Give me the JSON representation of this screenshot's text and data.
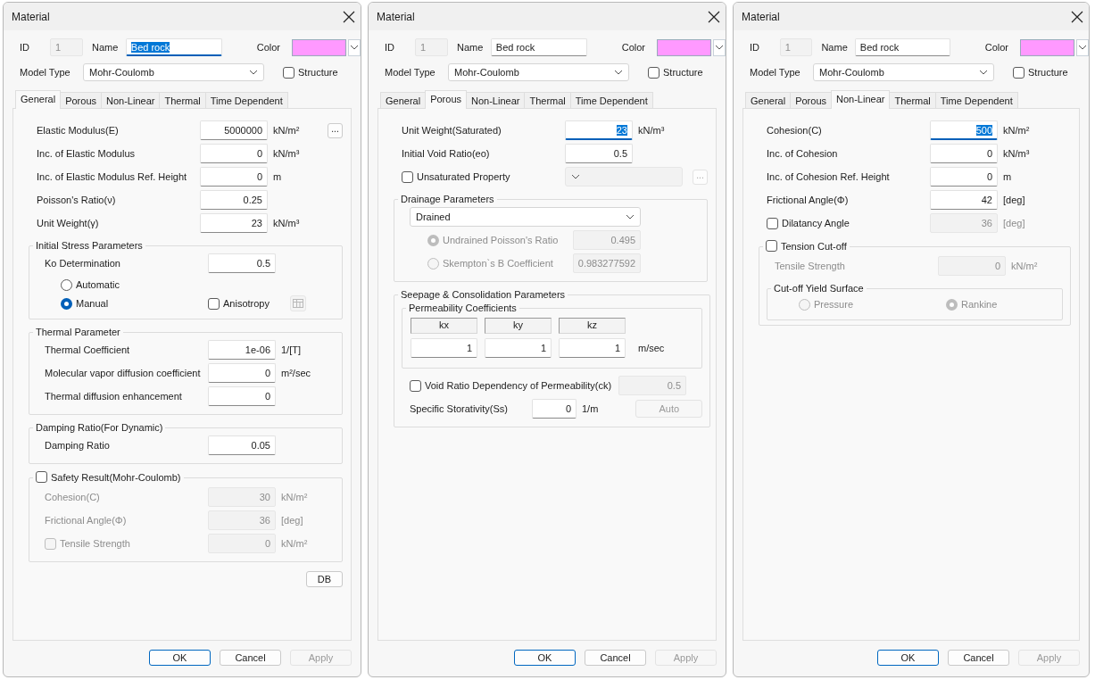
{
  "dialogs": [
    {
      "title": "Material",
      "id_label": "ID",
      "id": {
        "value": "1",
        "disabled": true
      },
      "name_label": "Name",
      "name": {
        "value": "Bed rock",
        "focused": true
      },
      "color_label": "Color",
      "color": "#ff99ff",
      "model_type_label": "Model Type",
      "model_type": "Mohr-Coulomb",
      "structure": {
        "label": "Structure",
        "checked": false
      },
      "tabs": [
        {
          "label": "General",
          "selected": true
        },
        {
          "label": "Porous",
          "selected": false
        },
        {
          "label": "Non-Linear",
          "selected": false
        },
        {
          "label": "Thermal",
          "selected": false
        },
        {
          "label": "Time Dependent",
          "selected": false
        }
      ],
      "content": [
        {
          "kind": "field",
          "label": "Elastic Modulus(E)",
          "value": "5000000",
          "unit": "kN/m²",
          "disabled": false,
          "input_disabled": false,
          "focused": false,
          "more_button": "..."
        },
        {
          "kind": "field",
          "label": "Inc. of Elastic Modulus",
          "value": "0",
          "unit": "kN/m³",
          "disabled": false,
          "input_disabled": false,
          "focused": false
        },
        {
          "kind": "field",
          "label": "Inc. of Elastic Modulus Ref. Height",
          "value": "0",
          "unit": "m",
          "disabled": false,
          "input_disabled": false,
          "focused": false
        },
        {
          "kind": "field",
          "label": "Poisson's Ratio(ν)",
          "value": "0.25",
          "disabled": false,
          "input_disabled": false,
          "focused": false
        },
        {
          "kind": "field",
          "label": "Unit Weight(γ)",
          "value": "23",
          "unit": "kN/m³",
          "disabled": false,
          "input_disabled": false,
          "focused": false
        },
        {
          "kind": "group",
          "title": "Initial Stress Parameters",
          "rows": [
            {
              "kind": "field",
              "label": "Ko Determination",
              "value": "0.5",
              "disabled": false,
              "input_disabled": false,
              "focused": false
            },
            {
              "kind": "options",
              "items": [
                {
                  "kind": "radio",
                  "label": "Automatic",
                  "selected": false,
                  "disabled": false
                }
              ]
            },
            {
              "kind": "options",
              "items": [
                {
                  "kind": "radio",
                  "label": "Manual",
                  "selected": true,
                  "disabled": false
                },
                {
                  "kind": "checkbox",
                  "label": "Anisotropy",
                  "checked": false,
                  "disabled": false
                },
                {
                  "kind": "icon_button",
                  "disabled": true
                }
              ]
            }
          ]
        },
        {
          "kind": "group",
          "title": "Thermal Parameter",
          "rows": [
            {
              "kind": "field",
              "label": "Thermal Coefficient",
              "value": "1e-06",
              "unit": "1/[T]",
              "disabled": false,
              "input_disabled": false,
              "focused": false
            },
            {
              "kind": "field",
              "label": "Molecular vapor diffusion coefficient",
              "value": "0",
              "unit": "m²/sec",
              "disabled": false,
              "input_disabled": false,
              "focused": false
            },
            {
              "kind": "field",
              "label": "Thermal diffusion enhancement",
              "value": "0",
              "disabled": false,
              "input_disabled": false,
              "focused": false
            }
          ]
        },
        {
          "kind": "group",
          "title": "Damping Ratio(For Dynamic)",
          "rows": [
            {
              "kind": "field",
              "label": "Damping Ratio",
              "value": "0.05",
              "disabled": false,
              "input_disabled": false,
              "focused": false
            }
          ]
        },
        {
          "kind": "group",
          "title": "Safety Result(Mohr-Coulomb)",
          "checkbox": {
            "checked": false
          },
          "rows": [
            {
              "kind": "field",
              "label": "Cohesion(C)",
              "value": "30",
              "unit": "kN/m²",
              "disabled": true,
              "input_disabled": true,
              "focused": false
            },
            {
              "kind": "field",
              "label": "Frictional Angle(Φ)",
              "value": "36",
              "unit": "[deg]",
              "disabled": true,
              "input_disabled": true,
              "focused": false
            },
            {
              "kind": "field",
              "label": "Tensile Strength",
              "toggle": {
                "kind": "checkbox",
                "checked": false
              },
              "value": "0",
              "unit": "kN/m²",
              "disabled": true,
              "input_disabled": true,
              "focused": false
            }
          ]
        },
        {
          "kind": "button_row",
          "label": "DB"
        }
      ],
      "buttons": [
        {
          "label": "OK",
          "default": true,
          "disabled": false
        },
        {
          "label": "Cancel",
          "default": false,
          "disabled": false
        },
        {
          "label": "Apply",
          "default": false,
          "disabled": true
        }
      ]
    },
    {
      "title": "Material",
      "id_label": "ID",
      "id": {
        "value": "1",
        "disabled": true
      },
      "name_label": "Name",
      "name": {
        "value": "Bed rock",
        "focused": false
      },
      "color_label": "Color",
      "color": "#ff99ff",
      "model_type_label": "Model Type",
      "model_type": "Mohr-Coulomb",
      "structure": {
        "label": "Structure",
        "checked": false
      },
      "tabs": [
        {
          "label": "General",
          "selected": false
        },
        {
          "label": "Porous",
          "selected": true
        },
        {
          "label": "Non-Linear",
          "selected": false
        },
        {
          "label": "Thermal",
          "selected": false
        },
        {
          "label": "Time Dependent",
          "selected": false
        }
      ],
      "content": [
        {
          "kind": "field",
          "label": "Unit Weight(Saturated)",
          "value": "23",
          "unit": "kN/m³",
          "disabled": false,
          "input_disabled": false,
          "focused": true
        },
        {
          "kind": "field",
          "label": "Initial Void Ratio(eo)",
          "value": "0.5",
          "disabled": false,
          "input_disabled": false,
          "focused": false
        },
        {
          "kind": "field_select",
          "label": "Unsaturated Property",
          "toggle": {
            "kind": "checkbox",
            "checked": false
          },
          "disabled": false,
          "input_disabled": true,
          "more_button": "..."
        },
        {
          "kind": "group",
          "title": "Drainage Parameters",
          "rows": [
            {
              "kind": "select",
              "value": "Drained"
            },
            {
              "kind": "field",
              "label": "Undrained Poisson's Ratio",
              "toggle": {
                "kind": "radio",
                "selected": true
              },
              "value": "0.495",
              "disabled": true,
              "input_disabled": true,
              "focused": false
            },
            {
              "kind": "field",
              "label": "Skempton`s B Coefficient",
              "toggle": {
                "kind": "radio",
                "selected": false
              },
              "value": "0.983277592",
              "disabled": true,
              "input_disabled": true,
              "focused": false
            }
          ]
        },
        {
          "kind": "group",
          "title": "Seepage & Consolidation Parameters",
          "rows": [
            {
              "kind": "matrix",
              "title": "Permeability Coefficients",
              "columns": [
                "kx",
                "ky",
                "kz"
              ],
              "values": [
                "1",
                "1",
                "1"
              ],
              "unit": "m/sec"
            },
            {
              "kind": "field_wide",
              "label": "Void Ratio Dependency of Permeability(ck)",
              "toggle": {
                "kind": "checkbox",
                "checked": false
              },
              "value": "0.5",
              "disabled": false,
              "input_disabled": true,
              "focused": false
            },
            {
              "kind": "field_short",
              "label": "Specific Storativity(Ss)",
              "value": "0",
              "unit": "1/m",
              "disabled": false,
              "input_disabled": false,
              "focused": false,
              "button": {
                "label": "Auto",
                "disabled": true
              }
            }
          ]
        }
      ],
      "buttons": [
        {
          "label": "OK",
          "default": true,
          "disabled": false
        },
        {
          "label": "Cancel",
          "default": false,
          "disabled": false
        },
        {
          "label": "Apply",
          "default": false,
          "disabled": true
        }
      ]
    },
    {
      "title": "Material",
      "id_label": "ID",
      "id": {
        "value": "1",
        "disabled": true
      },
      "name_label": "Name",
      "name": {
        "value": "Bed rock",
        "focused": false
      },
      "color_label": "Color",
      "color": "#ff99ff",
      "model_type_label": "Model Type",
      "model_type": "Mohr-Coulomb",
      "structure": {
        "label": "Structure",
        "checked": false
      },
      "tabs": [
        {
          "label": "General",
          "selected": false
        },
        {
          "label": "Porous",
          "selected": false
        },
        {
          "label": "Non-Linear",
          "selected": true
        },
        {
          "label": "Thermal",
          "selected": false
        },
        {
          "label": "Time Dependent",
          "selected": false
        }
      ],
      "content": [
        {
          "kind": "field",
          "label": "Cohesion(C)",
          "value": "500",
          "unit": "kN/m²",
          "disabled": false,
          "input_disabled": false,
          "focused": true
        },
        {
          "kind": "field",
          "label": "Inc. of Cohesion",
          "value": "0",
          "unit": "kN/m³",
          "disabled": false,
          "input_disabled": false,
          "focused": false
        },
        {
          "kind": "field",
          "label": "Inc. of Cohesion Ref. Height",
          "value": "0",
          "unit": "m",
          "disabled": false,
          "input_disabled": false,
          "focused": false
        },
        {
          "kind": "field",
          "label": "Frictional Angle(Φ)",
          "value": "42",
          "unit": "[deg]",
          "disabled": false,
          "input_disabled": false,
          "focused": false
        },
        {
          "kind": "field",
          "label": "Dilatancy Angle",
          "toggle": {
            "kind": "checkbox",
            "checked": false
          },
          "value": "36",
          "unit": "[deg]",
          "disabled": false,
          "input_disabled": true,
          "focused": false
        },
        {
          "kind": "group",
          "title": "Tension Cut-off",
          "checkbox": {
            "checked": false
          },
          "rows": [
            {
              "kind": "field",
              "label": "Tensile Strength",
              "value": "0",
              "unit": "kN/m²",
              "disabled": true,
              "input_disabled": true,
              "focused": false
            },
            {
              "kind": "group",
              "title": "Cut-off Yield Surface",
              "rows": [
                {
                  "kind": "options",
                  "items": [
                    {
                      "kind": "radio",
                      "label": "Pressure",
                      "selected": false,
                      "disabled": true
                    },
                    {
                      "kind": "radio",
                      "label": "Rankine",
                      "selected": true,
                      "disabled": true
                    }
                  ]
                }
              ]
            }
          ]
        }
      ],
      "buttons": [
        {
          "label": "OK",
          "default": true,
          "disabled": false
        },
        {
          "label": "Cancel",
          "default": false,
          "disabled": false
        },
        {
          "label": "Apply",
          "default": false,
          "disabled": true
        }
      ]
    }
  ]
}
